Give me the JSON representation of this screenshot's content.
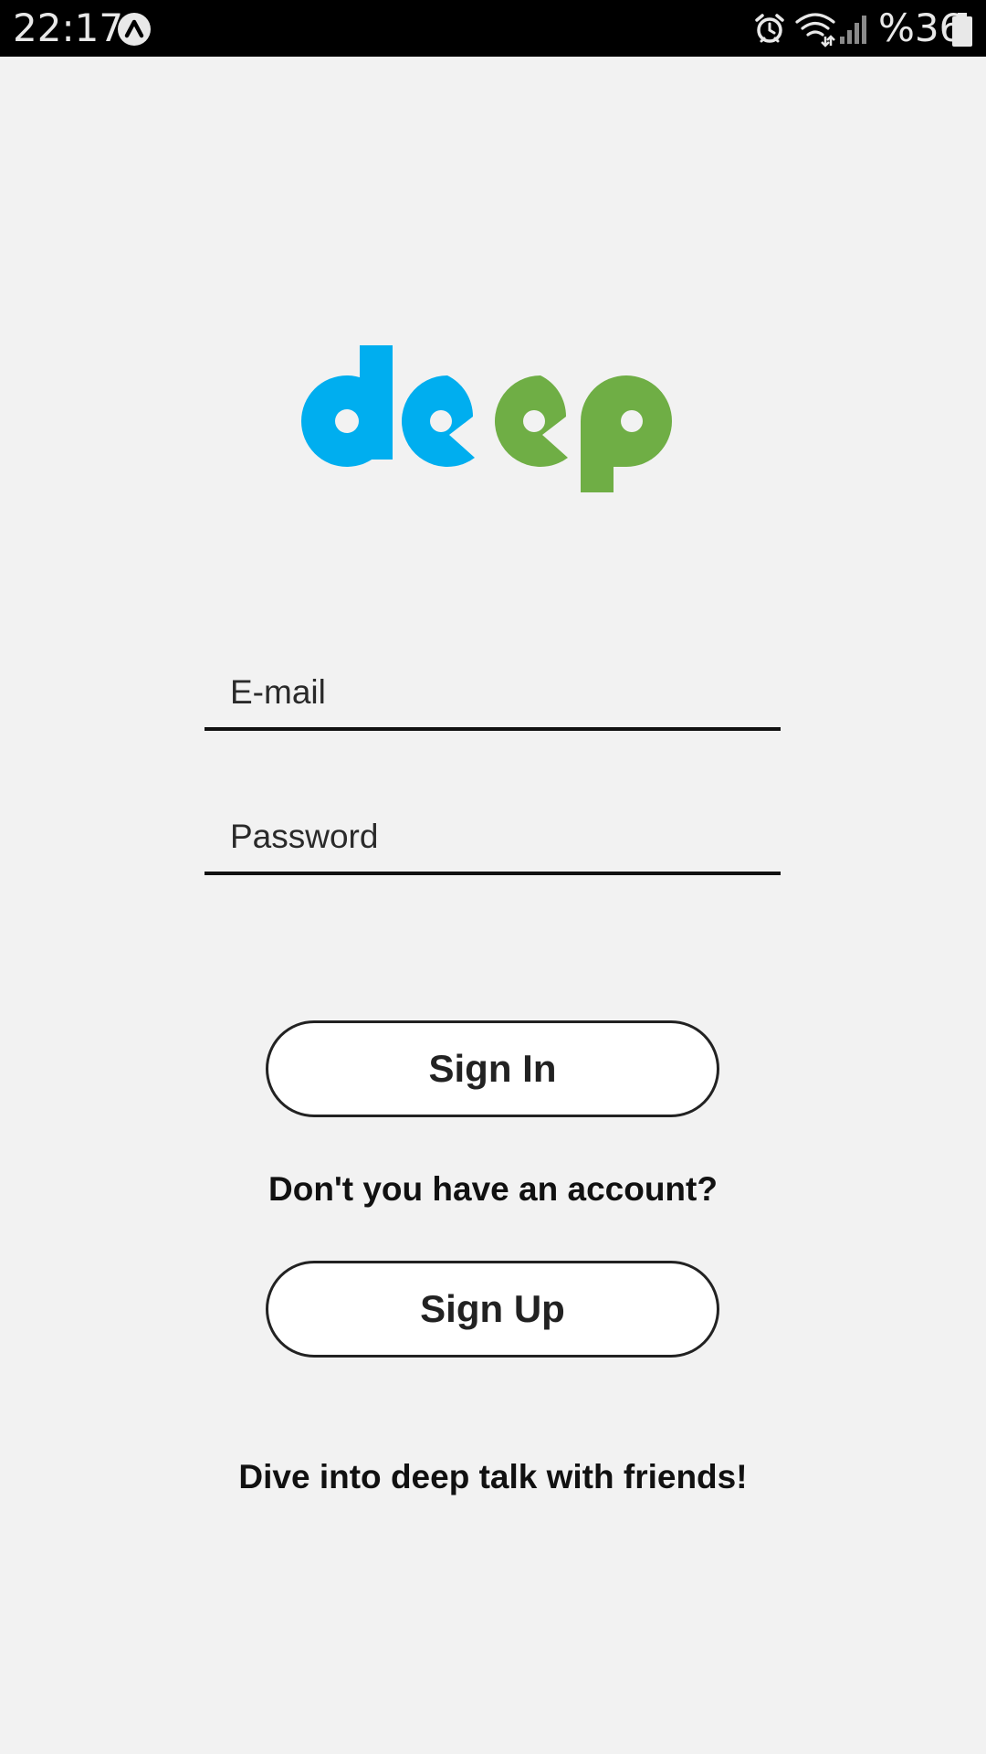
{
  "status_bar": {
    "time": "22:17",
    "battery_text": "%36",
    "icons": [
      "app-notification-icon",
      "alarm-icon",
      "wifi-icon",
      "signal-icon",
      "battery-icon"
    ]
  },
  "logo": {
    "text": "deep",
    "colors": {
      "blue": "#00aeef",
      "green": "#6fae45"
    }
  },
  "form": {
    "email_placeholder": "E-mail",
    "email_value": "",
    "password_placeholder": "Password",
    "password_value": ""
  },
  "buttons": {
    "sign_in": "Sign In",
    "sign_up": "Sign Up"
  },
  "text": {
    "no_account": "Don't you have an account?",
    "tagline": "Dive into deep talk with friends!"
  },
  "colors": {
    "background": "#f2f2f2",
    "status_bar": "#000000",
    "button_fill": "#ffffff",
    "button_border": "#222222"
  }
}
